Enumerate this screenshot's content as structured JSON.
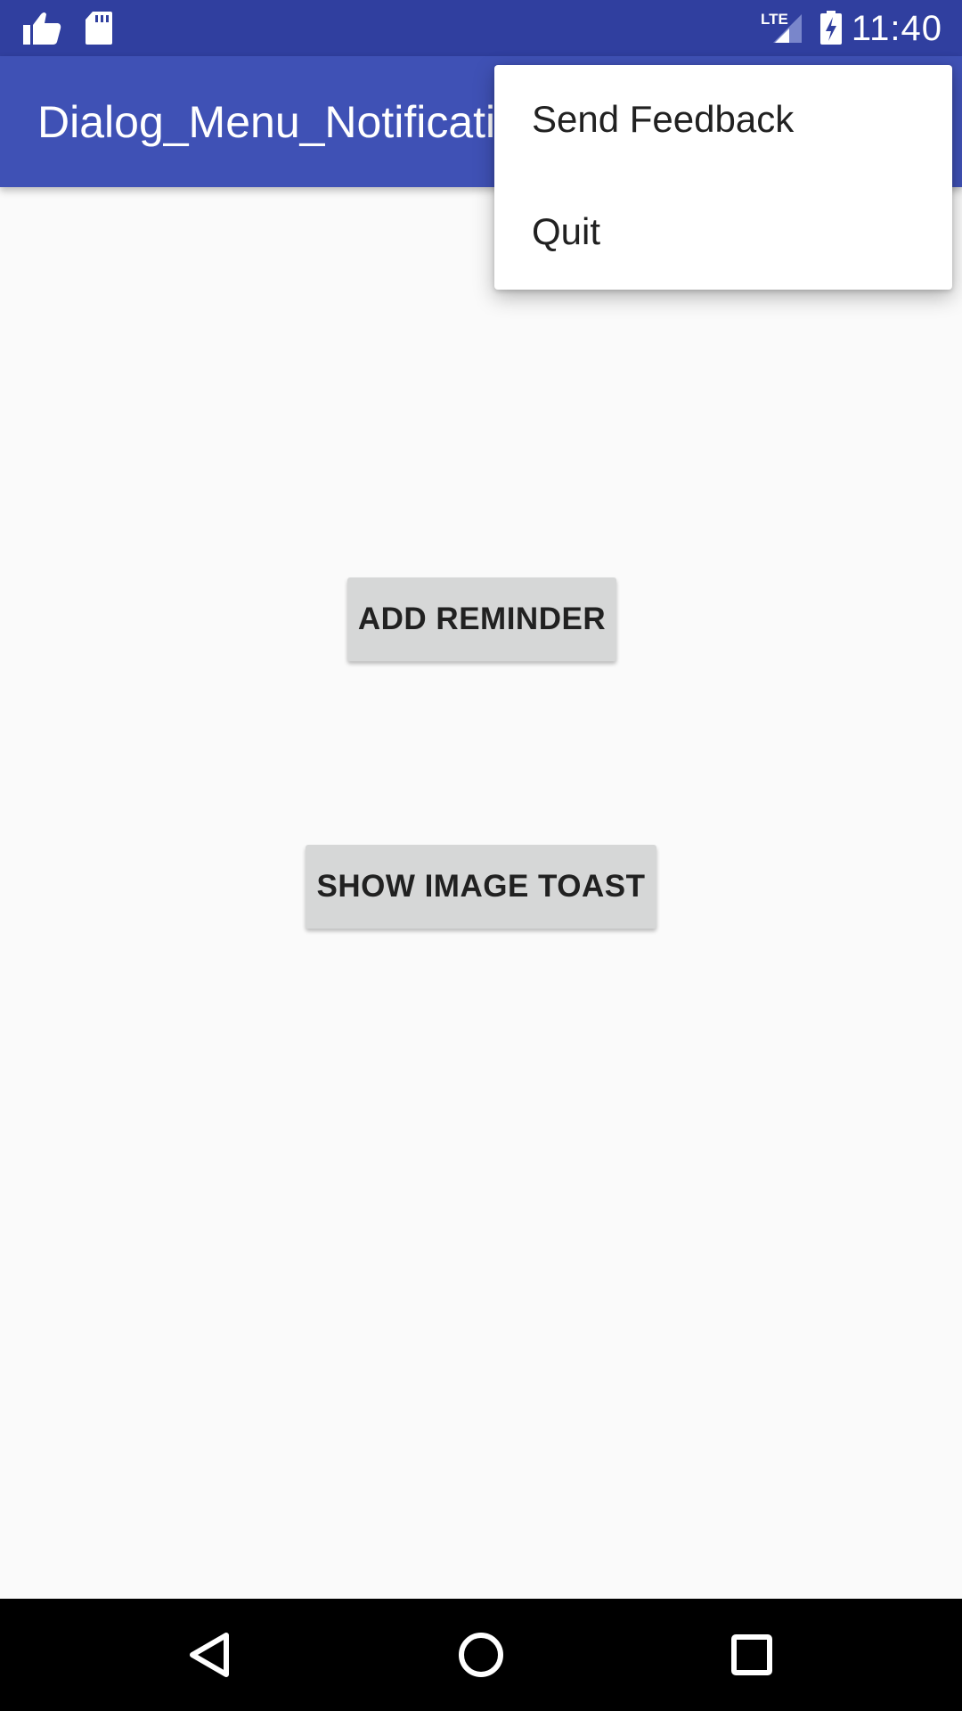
{
  "status_bar": {
    "time": "11:40",
    "icons": [
      "thumbs-up-icon",
      "sd-card-icon",
      "lte-signal-icon",
      "battery-charging-icon"
    ],
    "lte_label": "LTE"
  },
  "app_bar": {
    "title": "Dialog_Menu_Notification"
  },
  "overflow_menu": {
    "items": [
      {
        "label": "Send Feedback"
      },
      {
        "label": "Quit"
      }
    ]
  },
  "main": {
    "add_reminder_label": "ADD REMINDER",
    "show_image_toast_label": "SHOW IMAGE TOAST"
  },
  "nav_bar": {
    "buttons": [
      "back-icon",
      "home-icon",
      "recents-icon"
    ]
  },
  "colors": {
    "status_bar": "#303f9f",
    "app_bar": "#3f51b5",
    "background": "#fafafa",
    "button": "#d6d7d7"
  }
}
